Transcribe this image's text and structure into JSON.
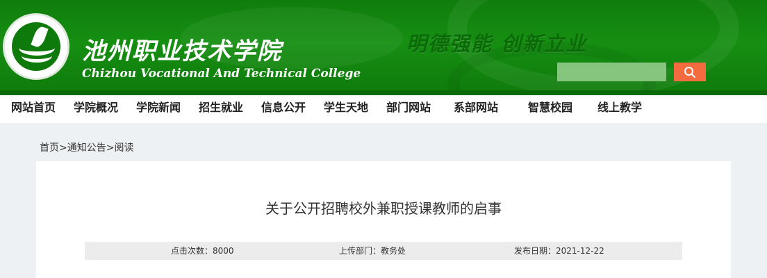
{
  "header": {
    "cn_name": "池州职业技术学院",
    "en_name": "Chizhou Vocational And Technical College",
    "motto": "明德强能   创新立业",
    "logo_text": "池州职业技术学院",
    "search": {
      "value": "",
      "placeholder": ""
    },
    "search_icon": "search-icon",
    "colors": {
      "green": "#0e7a0b",
      "search_field": "#85c57d",
      "search_button": "#f46b3f"
    }
  },
  "nav": {
    "items": [
      "网站首页",
      "学院概况",
      "学院新闻",
      "招生就业",
      "信息公开",
      "学生天地",
      "部门网站",
      "系部网站",
      "智慧校园",
      "线上教学"
    ]
  },
  "breadcrumb": "首页>通知公告>阅读",
  "article": {
    "title": "关于公开招聘校外兼职授课教师的启事",
    "meta": {
      "views": "点击次数：8000",
      "department": "上传部门：教务处",
      "date": "发布日期：2021-12-22"
    }
  }
}
